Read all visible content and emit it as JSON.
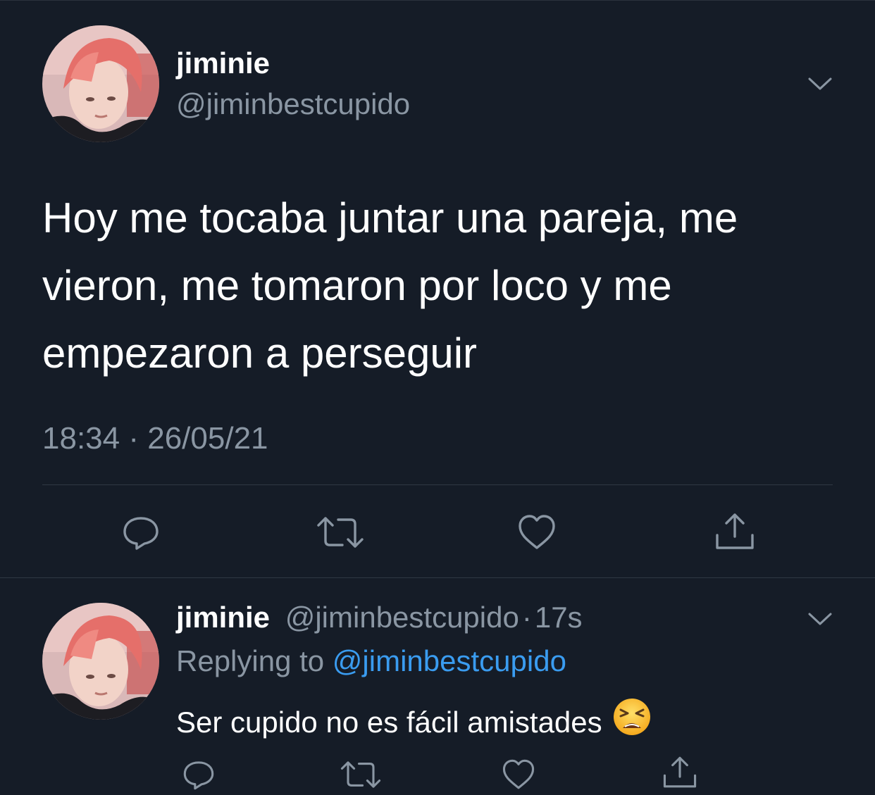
{
  "main_tweet": {
    "display_name": "jiminie",
    "handle": "@jiminbestcupido",
    "text_lines": [
      "Hoy me tocaba juntar una pareja, me",
      "vieron, me tomaron por loco y me",
      "empezaron a perseguir"
    ],
    "time": "18:34",
    "separator": "·",
    "date": "26/05/21",
    "actions": [
      "reply-icon",
      "retweet-icon",
      "like-icon",
      "share-icon"
    ]
  },
  "reply_tweet": {
    "display_name": "jiminie",
    "handle": "@jiminbestcupido",
    "separator": "·",
    "age": "17s",
    "replying_prefix": "Replying to ",
    "replying_to": "@jiminbestcupido",
    "text": "Ser cupido no es fácil amistades",
    "emoji": "tired-face-emoji",
    "actions": [
      "reply-icon",
      "retweet-icon",
      "like-icon",
      "share-icon"
    ]
  },
  "colors": {
    "background": "#151c27",
    "text": "#ffffff",
    "secondary": "#8a96a3",
    "link": "#3a9cf0",
    "divider": "#2f3844"
  }
}
